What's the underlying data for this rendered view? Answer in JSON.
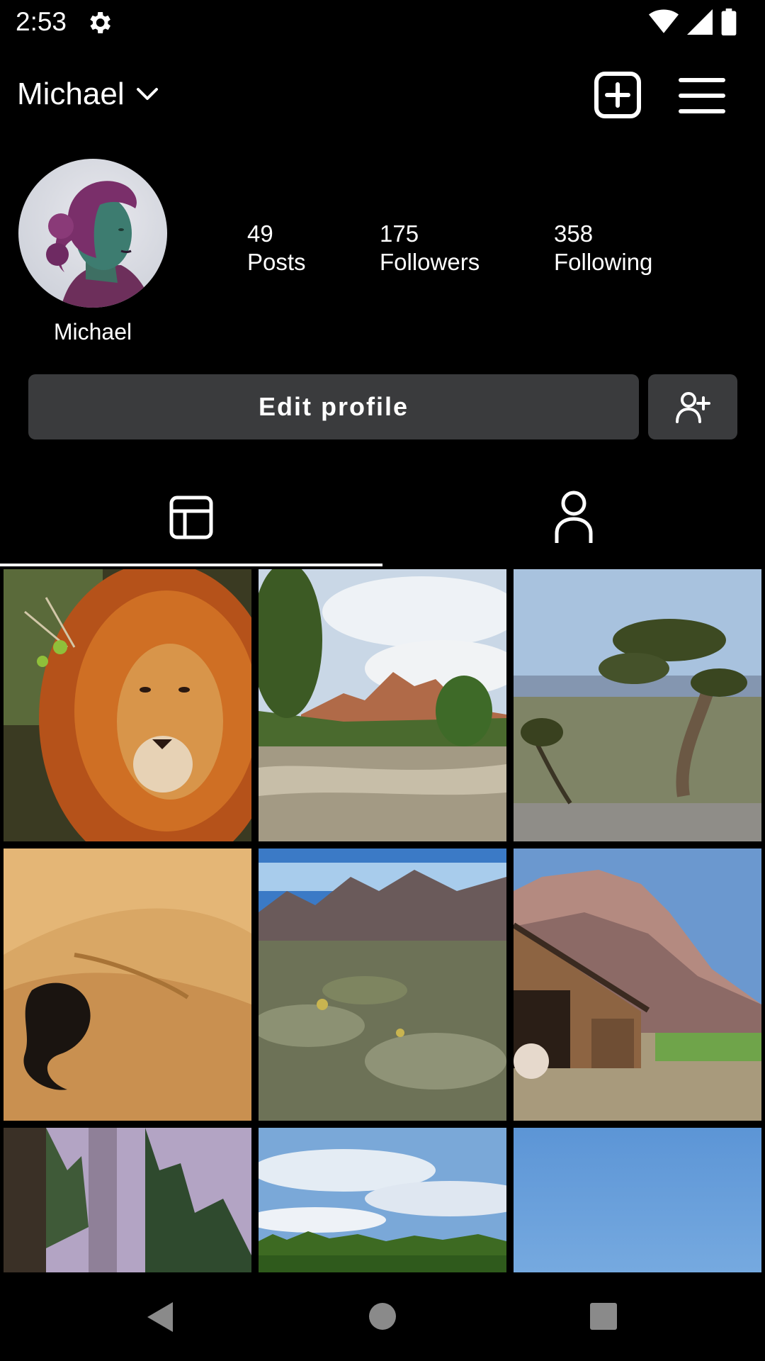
{
  "status_bar": {
    "time": "2:53"
  },
  "header": {
    "account_name": "Michael"
  },
  "profile": {
    "name": "Michael",
    "stats": [
      {
        "value": "49",
        "label": "Posts"
      },
      {
        "value": "175",
        "label": "Followers"
      },
      {
        "value": "358",
        "label": "Following"
      }
    ]
  },
  "actions": {
    "edit_label": "Edit profile"
  },
  "tabs": [
    {
      "icon": "grid-icon",
      "selected": true
    },
    {
      "icon": "tagged-person-icon",
      "selected": false
    }
  ],
  "grid": {
    "posts": [
      {
        "subject": "lion"
      },
      {
        "subject": "canyon-river"
      },
      {
        "subject": "tree-overlook"
      },
      {
        "subject": "sand-dune"
      },
      {
        "subject": "desert-mountains"
      },
      {
        "subject": "barn-cliff"
      },
      {
        "subject": "misty-forest"
      },
      {
        "subject": "treeline-sky"
      },
      {
        "subject": "blue-sky"
      }
    ]
  },
  "colors": {
    "background": "#000000",
    "button": "#3a3b3d",
    "text": "#ffffff"
  }
}
